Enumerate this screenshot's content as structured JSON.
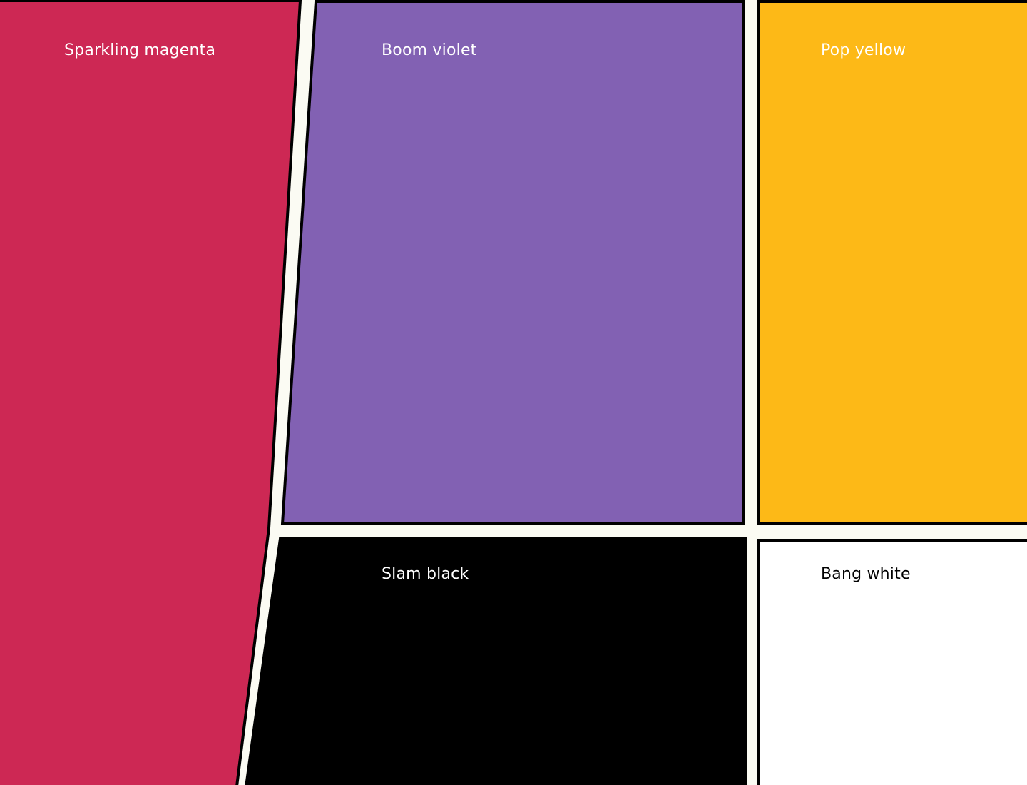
{
  "swatches": {
    "magenta": {
      "name": "Sparkling magenta",
      "color": "#cd2854",
      "text_color": "#ffffff"
    },
    "violet": {
      "name": "Boom violet",
      "color": "#8261b3",
      "text_color": "#ffffff"
    },
    "yellow": {
      "name": "Pop yellow",
      "color": "#fdb917",
      "text_color": "#ffffff"
    },
    "black": {
      "name": "Slam black",
      "color": "#000000",
      "text_color": "#ffffff"
    },
    "white": {
      "name": "Bang white",
      "color": "#ffffff",
      "text_color": "#000000"
    }
  },
  "colors": {
    "background": "#fbfbf3",
    "outline": "#000000"
  }
}
